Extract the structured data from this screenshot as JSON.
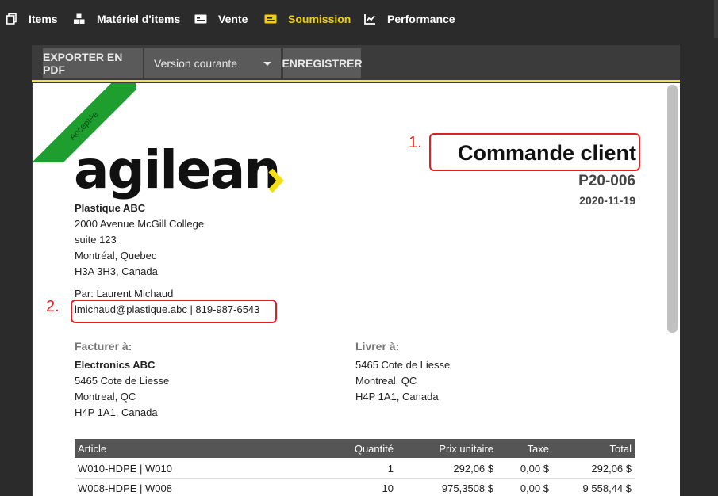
{
  "nav": {
    "items": [
      {
        "label": "Items",
        "icon": "copy-icon"
      },
      {
        "label": "Matériel d'items",
        "icon": "cubes-icon"
      },
      {
        "label": "Vente",
        "icon": "card-icon"
      },
      {
        "label": "Soumission",
        "icon": "ticket-icon"
      },
      {
        "label": "Performance",
        "icon": "chart-icon"
      }
    ],
    "active": "Soumission"
  },
  "toolbar": {
    "export_label": "EXPORTER EN PDF",
    "version_value": "Version courante",
    "save_label": "ENREGISTRER"
  },
  "document": {
    "status_ribbon": "Acceptée",
    "logo_text": "agilean",
    "title": "Commande client",
    "number": "P20-006",
    "date": "2020-11-19",
    "seller": {
      "name": "Plastique ABC",
      "address1": "2000 Avenue McGill College",
      "address2": "suite 123",
      "city": "Montréal, Quebec",
      "postal": "H3A 3H3, Canada",
      "by": "Par: Laurent Michaud",
      "contact": "lmichaud@plastique.abc | 819-987-6543"
    },
    "bill_to": {
      "heading": "Facturer à:",
      "name": "Electronics ABC",
      "address": "5465 Cote de Liesse",
      "city": "Montreal, QC",
      "postal": "H4P 1A1, Canada"
    },
    "ship_to": {
      "heading": "Livrer à:",
      "address": "5465 Cote de Liesse",
      "city": "Montreal, QC",
      "postal": "H4P 1A1, Canada"
    },
    "table": {
      "headers": {
        "article": "Article",
        "qty": "Quantité",
        "unit_price": "Prix unitaire",
        "tax": "Taxe",
        "total": "Total"
      },
      "rows": [
        {
          "article": "W010-HDPE | W010",
          "qty": "1",
          "unit_price": "292,06 $",
          "tax": "0,00 $",
          "total": "292,06 $"
        },
        {
          "article": "W008-HDPE | W008",
          "qty": "10",
          "unit_price": "975,3508 $",
          "tax": "0,00 $",
          "total": "9 558,44 $"
        }
      ]
    }
  },
  "annotations": {
    "one": "1.",
    "two": "2."
  },
  "colors": {
    "accent": "#f0d000",
    "ribbon": "#1e9e2e",
    "annotation": "#e02020",
    "logo_chevron": "#f2e014"
  }
}
